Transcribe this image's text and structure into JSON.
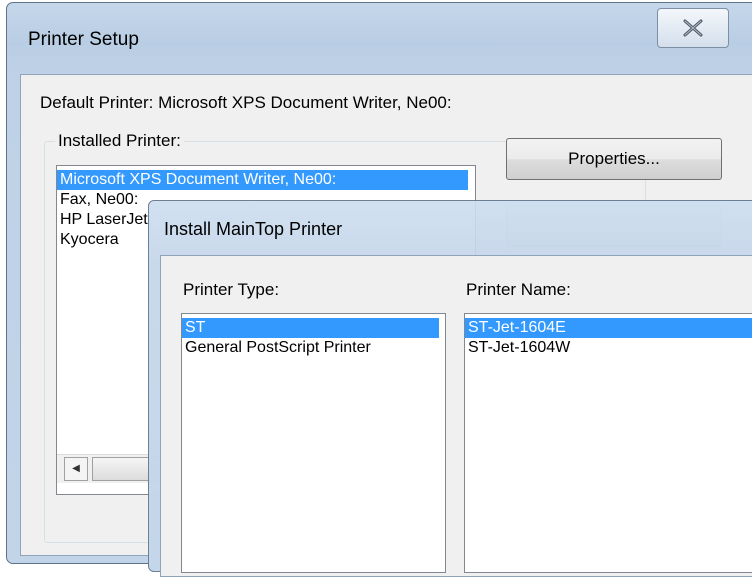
{
  "printer_setup": {
    "title": "Printer Setup",
    "close_icon": "close-icon",
    "default_printer_text": "Default Printer: Microsoft XPS Document Writer, Ne00:",
    "installed_label": "Installed Printer:",
    "printers": [
      "Microsoft XPS Document Writer, Ne00:",
      "Fax, Ne00:",
      "HP LaserJet",
      "Kyocera"
    ],
    "properties_label": "Properties..."
  },
  "install_dialog": {
    "title": "Install MainTop Printer",
    "printer_type_label": "Printer Type:",
    "printer_name_label": "Printer Name:",
    "printer_types": [
      "ST",
      "General PostScript Printer"
    ],
    "printer_names": [
      "ST-Jet-1604E",
      "ST-Jet-1604W"
    ]
  },
  "colors": {
    "selection": "#3399ff",
    "title_bar": "#c5d7ea",
    "client": "#f0f0f0"
  }
}
